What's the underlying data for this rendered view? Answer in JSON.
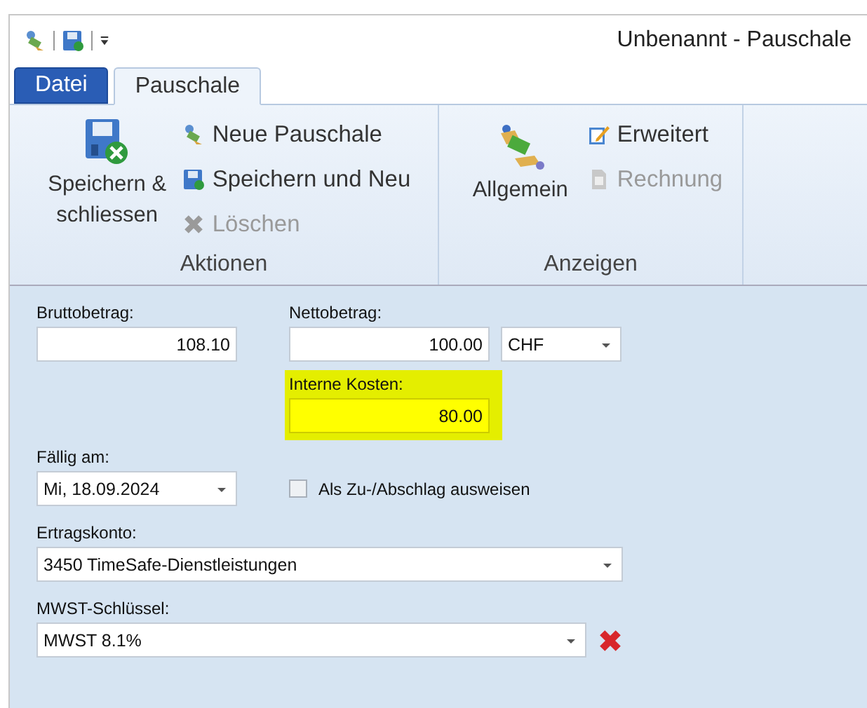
{
  "window": {
    "title": "Unbenannt - Pauschale"
  },
  "tabs": [
    {
      "label": "Datei",
      "kind": "file",
      "selected": false
    },
    {
      "label": "Pauschale",
      "kind": "normal",
      "selected": true
    }
  ],
  "ribbon": {
    "groups": [
      {
        "label": "Aktionen",
        "large": {
          "label": "Speichern & schliessen",
          "kind": "save-close"
        },
        "small": [
          {
            "label": "Neue Pauschale",
            "kind": "new",
            "disabled": false
          },
          {
            "label": "Speichern und Neu",
            "kind": "save-new",
            "disabled": false
          },
          {
            "label": "Löschen",
            "kind": "delete",
            "disabled": true
          }
        ]
      },
      {
        "label": "Anzeigen",
        "large": {
          "label": "Allgemein",
          "kind": "money"
        },
        "small": [
          {
            "label": "Erweitert",
            "kind": "edit",
            "disabled": false
          },
          {
            "label": "Rechnung",
            "kind": "doc",
            "disabled": true
          }
        ]
      }
    ]
  },
  "form": {
    "bruttobetrag": {
      "label": "Bruttobetrag:",
      "value": "108.10"
    },
    "nettobetrag": {
      "label": "Nettobetrag:",
      "value": "100.00",
      "currency": "CHF"
    },
    "interne_kosten": {
      "label": "Interne Kosten:",
      "value": "80.00",
      "highlighted": true
    },
    "faellig_am": {
      "label": "Fällig am:",
      "value": "Mi, 18.09.2024"
    },
    "zuschlag": {
      "label": "Als Zu-/Abschlag ausweisen",
      "checked": false
    },
    "ertragskonto": {
      "label": "Ertragskonto:",
      "value": "3450 TimeSafe-Dienstleistungen"
    },
    "mwst": {
      "label": "MWST-Schlüssel:",
      "value": "MWST 8.1%"
    }
  }
}
